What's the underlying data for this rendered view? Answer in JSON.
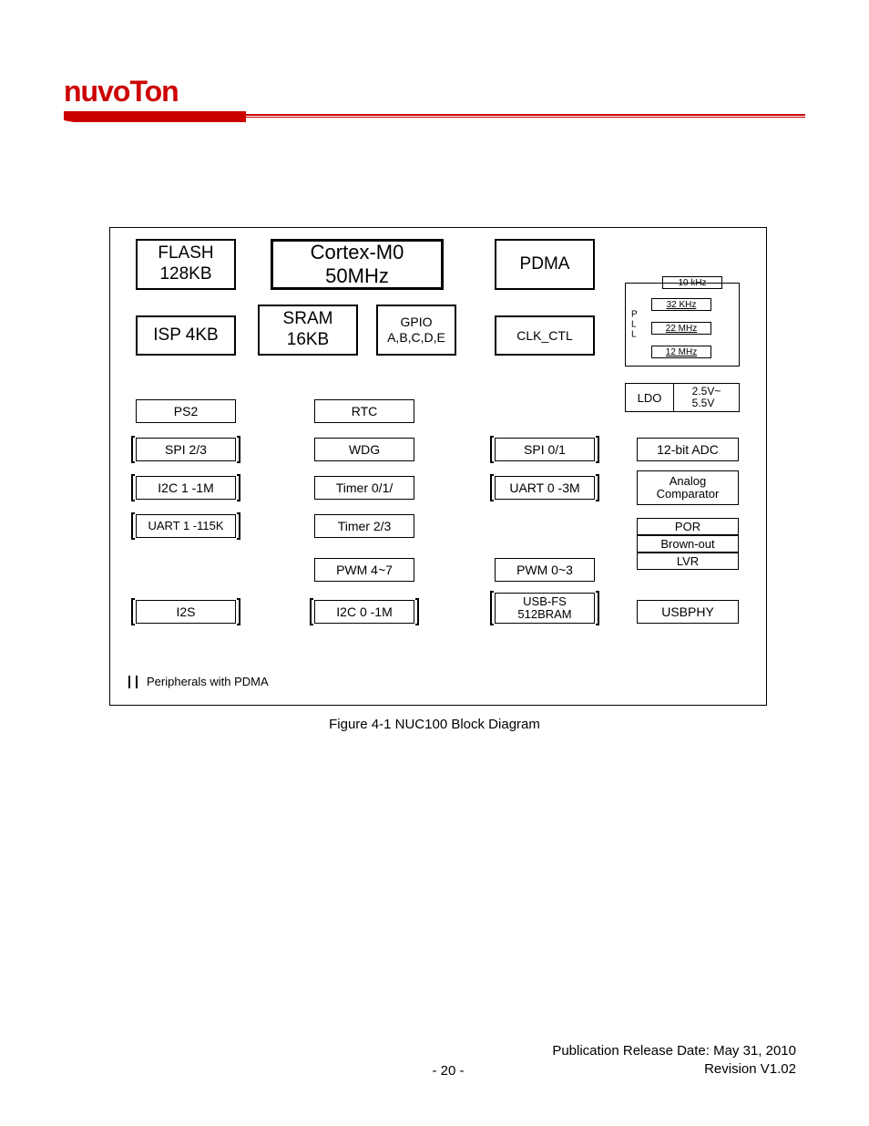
{
  "brand": "nuvoTon",
  "diagram": {
    "flash": {
      "l1": "FLASH",
      "l2": "128KB"
    },
    "cortex": {
      "l1": "Cortex-M0",
      "l2": "50MHz"
    },
    "pdma": "PDMA",
    "isp": "ISP 4KB",
    "sram": {
      "l1": "SRAM",
      "l2": "16KB"
    },
    "gpio": {
      "l1": "GPIO",
      "l2": "A,B,C,D,E"
    },
    "clk": "CLK_CTL",
    "pll_label": "P\nL\nL",
    "osc": [
      "10 kHz",
      "32 KHz",
      "22 MHz",
      "12 MHz"
    ],
    "ldo": {
      "l": "LDO",
      "r": "2.5V~\n5.5V"
    },
    "col1": [
      "PS2",
      "SPI 2/3",
      "I2C 1 -1M",
      "UART 1 -115K",
      "",
      "I2S"
    ],
    "col2": [
      "RTC",
      "WDG",
      "Timer 0/1/",
      "Timer 2/3",
      "PWM 4~7",
      "I2C 0 -1M"
    ],
    "col3": [
      "SPI 0/1",
      "UART 0 -3M",
      "PWM 0~3"
    ],
    "usb": {
      "l1": "USB-FS",
      "l2": "512BRAM"
    },
    "col4": [
      "12-bit ADC"
    ],
    "analog": {
      "l1": "Analog",
      "l2": "Comparator"
    },
    "stack3": [
      "POR",
      "Brown-out",
      "LVR"
    ],
    "usbphy": "USBPHY",
    "legend": "Peripherals with PDMA"
  },
  "caption": "Figure 4-1 NUC100 Block Diagram",
  "footer": {
    "page": "- 20 -",
    "pub": "Publication Release Date: May 31, 2010",
    "rev": "Revision V1.02"
  }
}
